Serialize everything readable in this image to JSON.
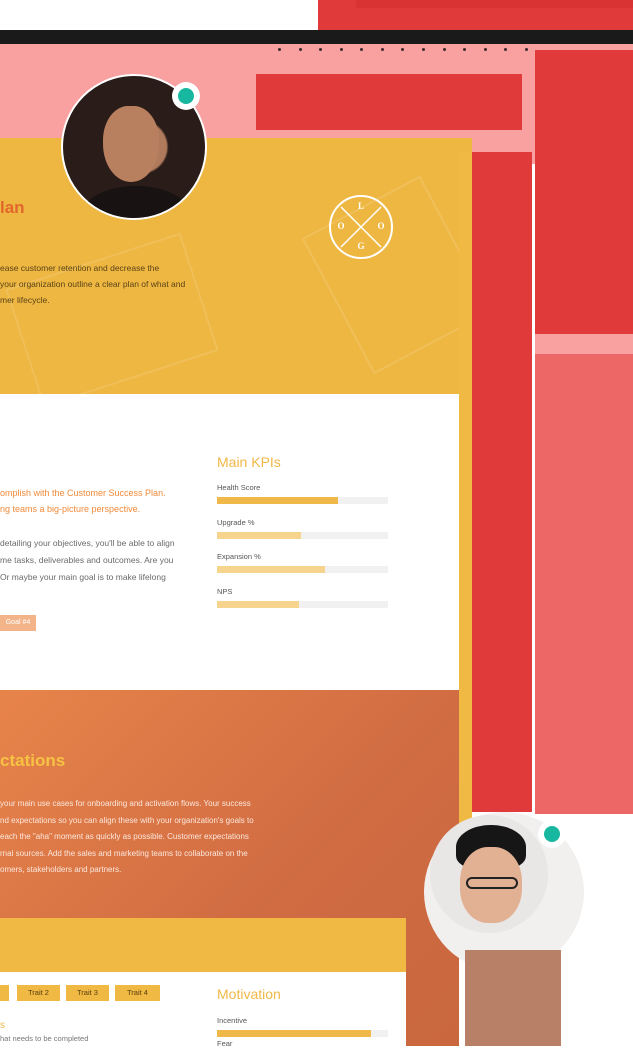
{
  "hero": {
    "title": "lan",
    "description": "ease customer retention and decrease the\n your organization outline a clear plan of what and\nmer lifecycle.",
    "logo_letters": [
      "L",
      "O",
      "G",
      "O"
    ]
  },
  "card": {
    "subtitle": "omplish with the Customer Success Plan.\nng teams a big-picture perspective.",
    "body": "detailing your objectives, you'll be able to align\nme tasks, deliverables and outcomes. Are you\nOr maybe your main goal is to make lifelong",
    "goal_pill": "Goal #4",
    "kpis": {
      "title": "Main KPIs",
      "items": [
        {
          "label": "Health Score",
          "value": 0.71,
          "color": "#f0b848"
        },
        {
          "label": "Upgrade %",
          "value": 0.49,
          "color": "#f7d48e"
        },
        {
          "label": "Expansion %",
          "value": 0.63,
          "color": "#f7d48e"
        },
        {
          "label": "NPS",
          "value": 0.48,
          "color": "#f7d48e"
        }
      ]
    }
  },
  "expectations": {
    "title": "ctations",
    "description": " your main use cases for onboarding and activation flows. Your success\nnd expectations so you can align these with your organization's goals to\neach the \"aha\" moment as quickly as possible. Customer expectations\nrnal sources. Add the sales and marketing teams to collaborate on the\nomers, stakeholders and partners."
  },
  "persona": {
    "traits": [
      "Trait 2",
      "Trait 3",
      "Trait 4"
    ],
    "small_title": "s",
    "small_text": "hat needs to be completed",
    "motivation": {
      "title": "Motivation",
      "items": [
        {
          "label": "Incentive",
          "value": 0.9,
          "color": "#f0b848"
        },
        {
          "label": "Fear",
          "value": 0.0,
          "color": "#f0b848"
        }
      ]
    }
  },
  "colors": {
    "accent_yellow": "#f0b943",
    "accent_orange": "#e2672c",
    "online_green": "#18b79f",
    "red": "#e03a3a"
  }
}
